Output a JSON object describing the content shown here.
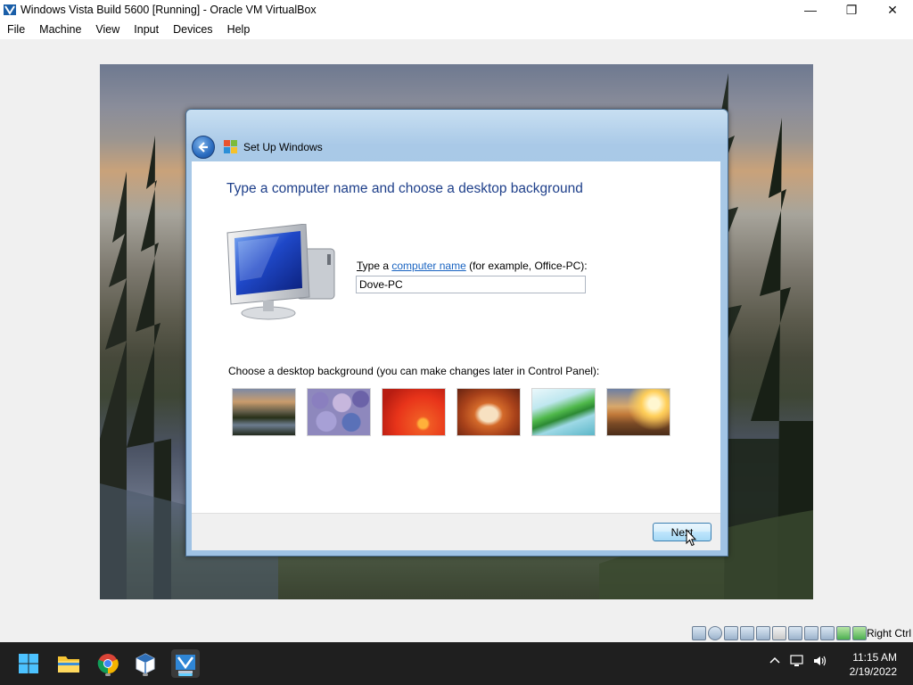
{
  "window": {
    "title": "Windows Vista Build 5600 [Running] - Oracle VM VirtualBox",
    "minimize_glyph": "—",
    "restore_glyph": "❐",
    "close_glyph": "✕"
  },
  "menu": {
    "items": [
      "File",
      "Machine",
      "View",
      "Input",
      "Devices",
      "Help"
    ]
  },
  "dialog": {
    "title": "Set Up Windows",
    "heading": "Type a computer name and choose a desktop background",
    "name_label_prefix_u": "T",
    "name_label_prefix_rest": "ype a ",
    "name_label_link": "computer name",
    "name_label_suffix": " (for example, Office-PC):",
    "computer_name_value": "Dove-PC",
    "background_label": "Choose a desktop background (you can make changes later in Control Panel):",
    "backgrounds": [
      "mountain-lake",
      "pebbles",
      "red-flower",
      "rock-arch",
      "palm-leaf",
      "sunset-grass"
    ],
    "next_label": "Next",
    "back_icon": "back-arrow-icon"
  },
  "statusbar": {
    "host_key": "Right Ctrl",
    "icons": [
      "hard-disk-icon",
      "optical-drive-icon",
      "audio-icon",
      "network-icon",
      "usb-icon",
      "shared-folders-icon",
      "display-icon",
      "recording-icon",
      "vt-x-icon",
      "mouse-integration-icon",
      "keyboard-icon"
    ]
  },
  "taskbar": {
    "apps": [
      "start-icon",
      "file-explorer-icon",
      "chrome-icon",
      "virtualbox-icon",
      "vista-vm-icon"
    ],
    "time": "11:15 AM",
    "date": "2/19/2022"
  },
  "colors": {
    "heading": "#1e3f8a",
    "link": "#1863c1",
    "taskbar": "#1f1f1f",
    "accent": "#60cdff"
  }
}
